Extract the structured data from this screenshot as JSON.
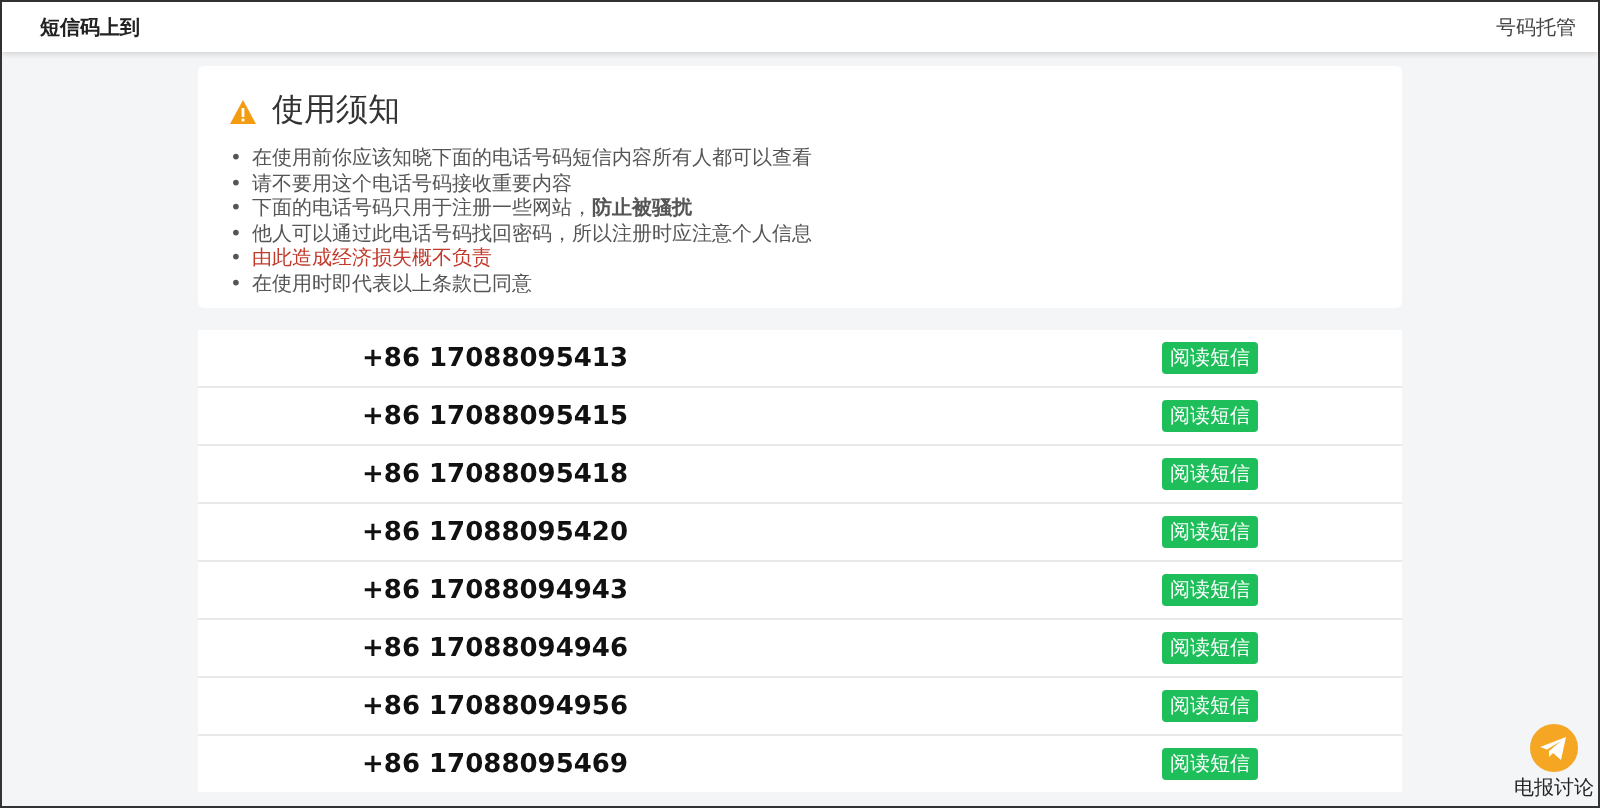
{
  "header": {
    "title": "短信码上到",
    "link": "号码托管"
  },
  "notice": {
    "title": "使用须知",
    "items": [
      {
        "bullet": "•",
        "text": "在使用前你应该知晓下面的电话号码短信内容所有人都可以查看",
        "kind": "normal"
      },
      {
        "bullet": "•",
        "text": "请不要用这个电话号码接收重要内容",
        "kind": "normal"
      },
      {
        "bullet": "•",
        "text": "下面的电话号码只用于注册一些网站，**防止被骚扰**",
        "kind": "normal"
      },
      {
        "bullet": "•",
        "text": "他人可以通过此电话号码找回密码，所以注册时应注意个人信息",
        "kind": "normal"
      },
      {
        "bullet": "•",
        "text": "由此造成经济损失概不负责",
        "kind": "warning"
      },
      {
        "bullet": "•",
        "text": "在使用时即代表以上条款已同意",
        "kind": "normal"
      }
    ]
  },
  "numbers": [
    {
      "number": "+86 17088095413",
      "button": "阅读短信"
    },
    {
      "number": "+86 17088095415",
      "button": "阅读短信"
    },
    {
      "number": "+86 17088095418",
      "button": "阅读短信"
    },
    {
      "number": "+86 17088095420",
      "button": "阅读短信"
    },
    {
      "number": "+86 17088094943",
      "button": "阅读短信"
    },
    {
      "number": "+86 17088094946",
      "button": "阅读短信"
    },
    {
      "number": "+86 17088094956",
      "button": "阅读短信"
    },
    {
      "number": "+86 17088095469",
      "button": "阅读短信"
    }
  ],
  "chat_button": {
    "label": "电报讨论"
  }
}
